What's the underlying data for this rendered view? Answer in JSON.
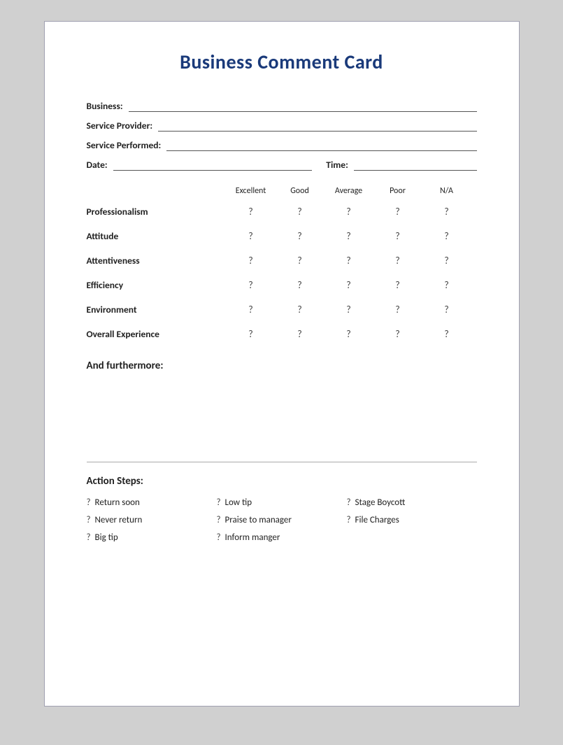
{
  "card": {
    "title": "Business Comment Card",
    "form": {
      "business_label": "Business:",
      "service_provider_label": "Service Provider:",
      "service_performed_label": "Service Performed:",
      "date_label": "Date:",
      "time_label": "Time:"
    },
    "ratings": {
      "headers": [
        "Excellent",
        "Good",
        "Average",
        "Poor",
        "N/A"
      ],
      "rows": [
        {
          "label": "Professionalism",
          "values": [
            "?",
            "?",
            "?",
            "?",
            "?"
          ]
        },
        {
          "label": "Attitude",
          "values": [
            "?",
            "?",
            "?",
            "?",
            "?"
          ]
        },
        {
          "label": "Attentiveness",
          "values": [
            "?",
            "?",
            "?",
            "?",
            "?"
          ]
        },
        {
          "label": "Efficiency",
          "values": [
            "?",
            "?",
            "?",
            "?",
            "?"
          ]
        },
        {
          "label": "Environment",
          "values": [
            "?",
            "?",
            "?",
            "?",
            "?"
          ]
        },
        {
          "label": "Overall Experience",
          "values": [
            "?",
            "?",
            "?",
            "?",
            "?"
          ]
        }
      ]
    },
    "further_label": "And furthermore:",
    "action_steps": {
      "label": "Action Steps:",
      "items": [
        {
          "icon": "?",
          "text": "Return soon"
        },
        {
          "icon": "?",
          "text": "Low tip"
        },
        {
          "icon": "?",
          "text": "Stage Boycott"
        },
        {
          "icon": "?",
          "text": "Never return"
        },
        {
          "icon": "?",
          "text": "Praise to manager"
        },
        {
          "icon": "?",
          "text": "File Charges"
        },
        {
          "icon": "?",
          "text": "Big tip"
        },
        {
          "icon": "?",
          "text": "Inform manger"
        },
        {
          "icon": "",
          "text": ""
        }
      ]
    }
  }
}
